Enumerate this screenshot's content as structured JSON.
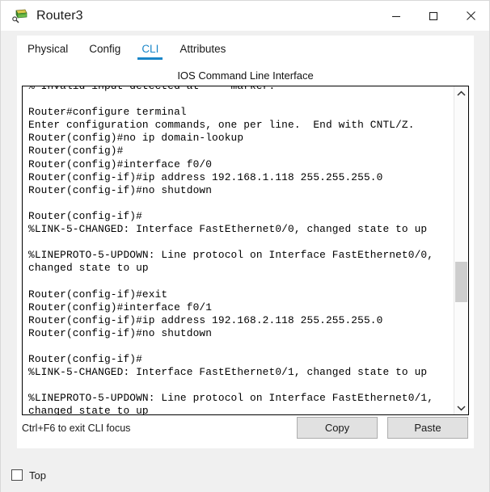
{
  "window": {
    "title": "Router3",
    "icon": "router-device-icon",
    "controls": {
      "minimize": "minimize-icon",
      "maximize": "maximize-icon",
      "close": "close-icon"
    }
  },
  "tabs": [
    {
      "label": "Physical",
      "active": false
    },
    {
      "label": "Config",
      "active": false
    },
    {
      "label": "CLI",
      "active": true
    },
    {
      "label": "Attributes",
      "active": false
    }
  ],
  "panel": {
    "heading": "IOS Command Line Interface"
  },
  "terminal": {
    "lines": [
      "% Invalid input detected at '^' marker.",
      "",
      "Router#configure terminal",
      "Enter configuration commands, one per line.  End with CNTL/Z.",
      "Router(config)#no ip domain-lookup",
      "Router(config)#",
      "Router(config)#interface f0/0",
      "Router(config-if)#ip address 192.168.1.118 255.255.255.0",
      "Router(config-if)#no shutdown",
      "",
      "Router(config-if)#",
      "%LINK-5-CHANGED: Interface FastEthernet0/0, changed state to up",
      "",
      "%LINEPROTO-5-UPDOWN: Line protocol on Interface FastEthernet0/0,",
      "changed state to up",
      "",
      "Router(config-if)#exit",
      "Router(config)#interface f0/1",
      "Router(config-if)#ip address 192.168.2.118 255.255.255.0",
      "Router(config-if)#no shutdown",
      "",
      "Router(config-if)#",
      "%LINK-5-CHANGED: Interface FastEthernet0/1, changed state to up",
      "",
      "%LINEPROTO-5-UPDOWN: Line protocol on Interface FastEthernet0/1,",
      "changed state to up"
    ]
  },
  "scrollbar": {
    "up_arrow": "chevron-up-icon",
    "down_arrow": "chevron-down-icon"
  },
  "footer_controls": {
    "hint": "Ctrl+F6 to exit CLI focus",
    "copy_label": "Copy",
    "paste_label": "Paste"
  },
  "footer": {
    "top_checkbox_label": "Top",
    "top_checked": false
  },
  "colors": {
    "accent": "#1a86c8",
    "window_bg": "#f0f0f0",
    "panel_bg": "#ffffff",
    "button_bg": "#e1e1e1",
    "scroll_thumb": "#cdcdcd"
  }
}
